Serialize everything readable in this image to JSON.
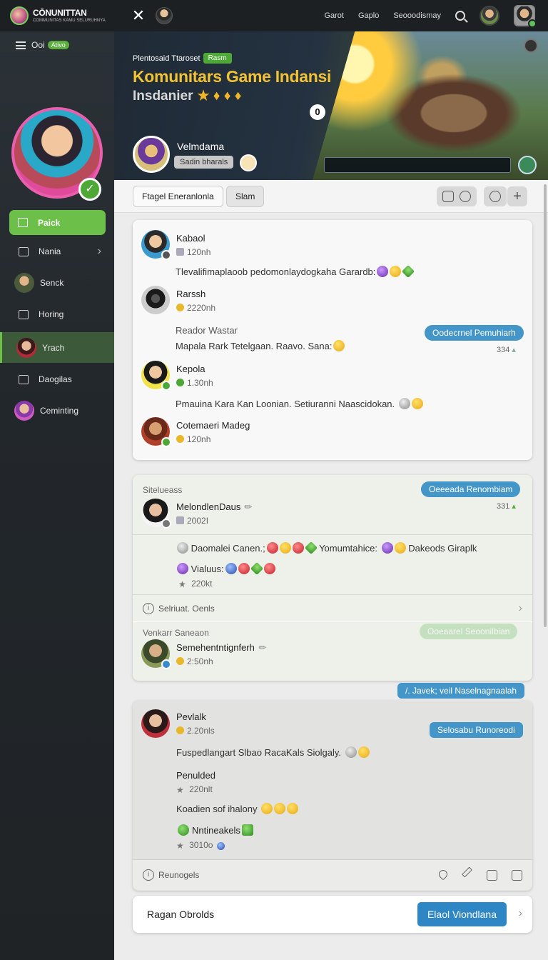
{
  "topbar": {
    "brand_name": "CŌNUNITTAN",
    "brand_sub": "COMMUNITAS KAMU SELURUHNYA",
    "nav": [
      "Garot",
      "Gaplo",
      "Seooodismay"
    ]
  },
  "sidebar": {
    "menu_label": "Ooi",
    "menu_badge": "Ativo",
    "primary_label": "Paick",
    "items": [
      {
        "label": "Nania"
      },
      {
        "label": "Senck"
      },
      {
        "label": "Horing"
      },
      {
        "label": "Yrach"
      },
      {
        "label": "Daogilas"
      },
      {
        "label": "Ceminting"
      }
    ]
  },
  "hero": {
    "kicker": "Plentosaid Ttaroset",
    "kicker_pill": "Rasm",
    "title": "Komunitars Game Indansi",
    "subtitle": "Insdanier",
    "stars": "★ ♦ ♦ ♦",
    "counter": "0",
    "owner_name": "Velmdama",
    "owner_tag": "Sadin bharals"
  },
  "tabs": {
    "tab1": "Ftagel Eneranlonla",
    "tab2": "Slam"
  },
  "feed": {
    "card1": {
      "posts": [
        {
          "name": "Kabaol",
          "time": "120nh",
          "text": "Tlevalifimaplaoob pedomonlaydogkaha Garardb:"
        },
        {
          "name": "Rarssh",
          "time": "2220nh",
          "text1": "Reador Wastar",
          "text2": "Mapala Rark Tetelgaan. Raavo. Sana:",
          "chip": "Oodecrnel Pemuhiarh",
          "meta": "334"
        },
        {
          "name": "Kepola",
          "time": "1.30nh",
          "text": "Pmauina Kara Kan Loonian. Setiuranni Naascidokan."
        },
        {
          "name": "Cotemaeri Madeg",
          "time": "120nh"
        }
      ]
    },
    "card2": {
      "section": "Sitelueass",
      "chip": "Oeeeada Renombiam",
      "meta": "331",
      "post": {
        "name": "MelondlenDaus",
        "time": "2002I",
        "line1_a": "Daomalei Canen.;",
        "line1_b": "Yomumtahice:",
        "line1_c": "Dakeods Giraplk",
        "line2": "Vialuus:",
        "stat": "220kt"
      },
      "footer": "Selriuat. Oenls",
      "section2": "Venkarr Saneaon",
      "chip2": "Ooeaarel Seoonilbian",
      "post2": {
        "name": "Semehentntignferh",
        "time": "2:50nh"
      }
    },
    "float_chip": "/. Javek; veil Naselnagnaalah",
    "card3": {
      "chip": "Selosabu Runoreodi",
      "post1": {
        "name": "Pevlalk",
        "time": "2.20nls",
        "text": "Fuspedlangart Slbao RacaKals Siolgaly."
      },
      "post2": {
        "name": "Penulded",
        "time": "220nlt",
        "text": "Koadien sof ihalony"
      },
      "post3": {
        "name": "Nntineakels",
        "time": "3010o"
      },
      "footer": "Reunogels"
    }
  },
  "bottom": {
    "label": "Ragan Obrolds",
    "button": "Elaol Viondlana"
  },
  "colors": {
    "accent_green": "#6cc04a",
    "accent_blue": "#2f86c5",
    "title_gold": "#f1c232"
  }
}
